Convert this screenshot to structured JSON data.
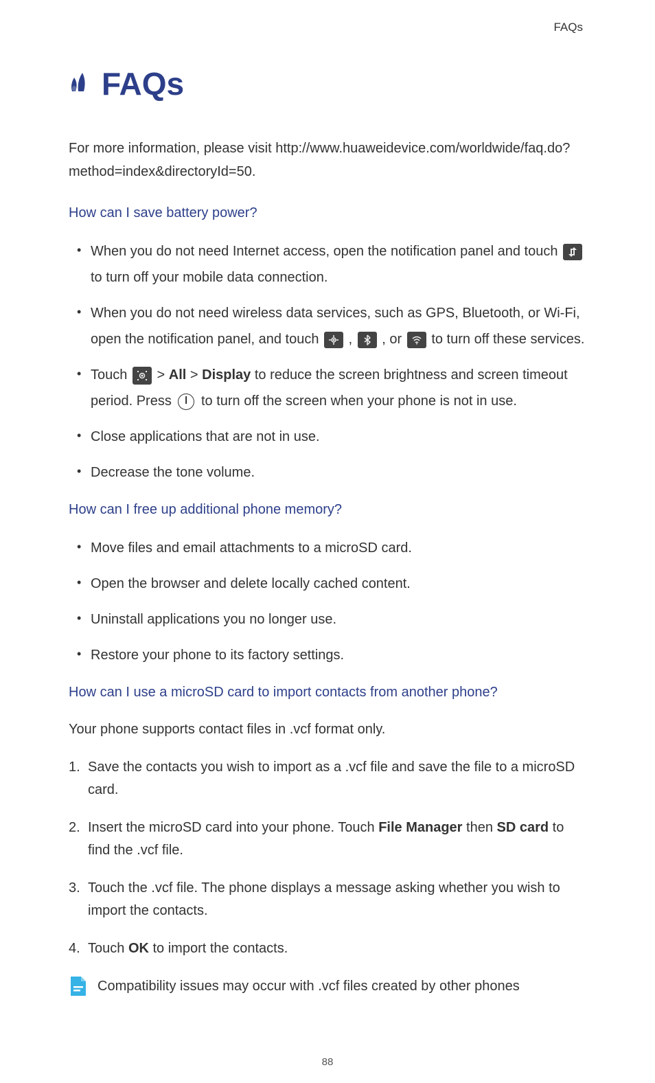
{
  "header": {
    "label": "FAQs"
  },
  "title": "FAQs",
  "intro": "For more information, please visit http://www.huaweidevice.com/worldwide/faq.do?method=index&directoryId=50.",
  "q1": {
    "question": "How can I save battery power?",
    "b1_a": "When you do not need Internet access, open the notification panel and touch ",
    "b1_b": " to turn off your mobile data connection.",
    "b2_a": "When you do not need wireless data services, such as GPS, Bluetooth, or Wi-Fi, open the notification panel, and touch ",
    "b2_b": ", ",
    "b2_c": ", or ",
    "b2_d": " to turn off these services.",
    "b3_a": "Touch ",
    "b3_b": " > ",
    "b3_all": "All",
    "b3_c": " > ",
    "b3_display": "Display",
    "b3_d": " to reduce the screen brightness and screen timeout period. Press ",
    "b3_e": " to turn off the screen when your phone is not in use.",
    "b4": "Close applications that are not in use.",
    "b5": "Decrease the tone volume."
  },
  "q2": {
    "question": "How can I free up additional phone memory?",
    "b1": "Move files and email attachments to a microSD card.",
    "b2": "Open the browser and delete locally cached content.",
    "b3": "Uninstall applications you no longer use.",
    "b4": "Restore your phone to its factory settings."
  },
  "q3": {
    "question": "How can I use a microSD card to import contacts from another phone?",
    "intro": "Your phone supports contact files in .vcf format only.",
    "n1": "Save the contacts you wish to import as a .vcf file and save the file to a microSD card.",
    "n2_a": "Insert the microSD card into your phone. Touch ",
    "n2_fm": "File Manager",
    "n2_b": " then ",
    "n2_sd": "SD card",
    "n2_c": " to find the .vcf file.",
    "n3": "Touch the .vcf file. The phone displays a message asking whether you wish to import the contacts.",
    "n4_a": "Touch ",
    "n4_ok": "OK",
    "n4_b": " to import the contacts.",
    "note": "Compatibility issues may occur with .vcf files created by other phones"
  },
  "page_number": "88"
}
